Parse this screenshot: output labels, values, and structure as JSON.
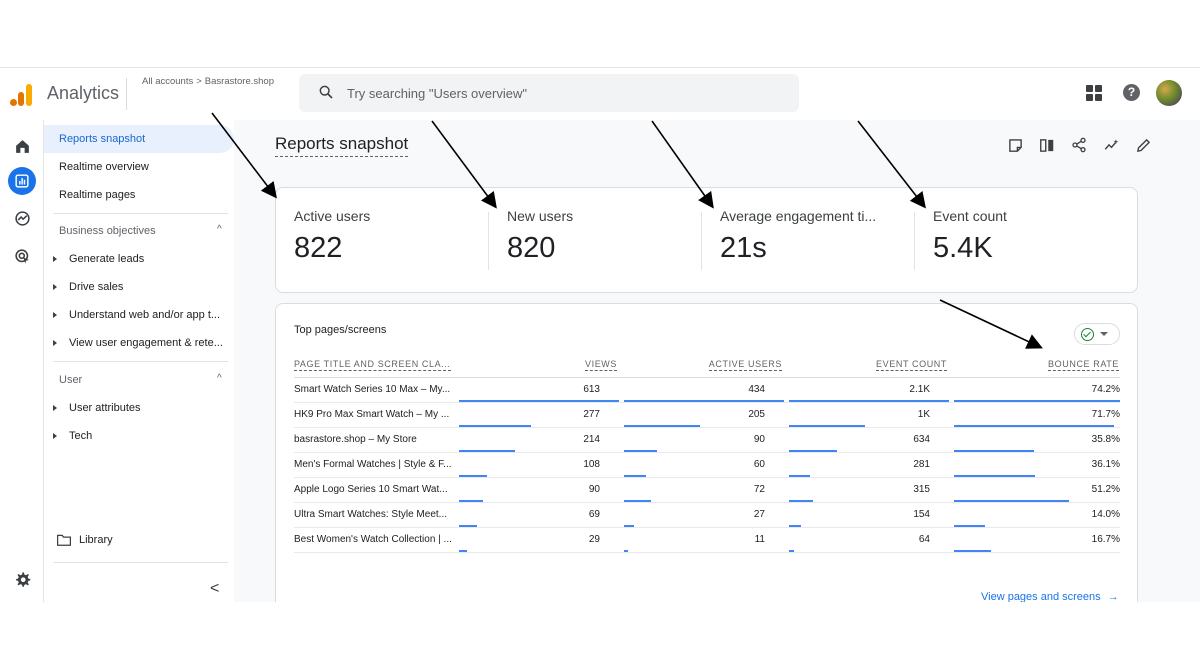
{
  "app": {
    "name": "Analytics",
    "breadcrumb": [
      "All accounts",
      "Basrastore.shop"
    ],
    "breadcrumb_sep": ">",
    "search_placeholder": "Try searching \"Users overview\"",
    "help_glyph": "?"
  },
  "icons": {
    "logo": "analytics-logo-icon",
    "search": "search-icon",
    "apps": "apps-grid-icon",
    "help": "help-icon",
    "home": "home-icon",
    "reports": "reports-icon",
    "explore": "explore-icon",
    "advertising": "advertising-icon",
    "settings": "gear-icon",
    "folder": "folder-icon"
  },
  "colors": {
    "accent": "#1a73e8",
    "active_bg": "#e8f0fe",
    "bar": "#4285f4",
    "logo_orange": "#e37400",
    "logo_yellow": "#f9ab00",
    "ok_green": "#188038"
  },
  "sidebar": {
    "items": [
      {
        "label": "Reports snapshot",
        "active": true
      },
      {
        "label": "Realtime overview",
        "active": false
      },
      {
        "label": "Realtime pages",
        "active": false
      }
    ],
    "sections": [
      {
        "title": "Business objectives",
        "caret": "^",
        "items": [
          "Generate leads",
          "Drive sales",
          "Understand web and/or app t...",
          "View user engagement & rete..."
        ]
      },
      {
        "title": "User",
        "caret": "^",
        "items": [
          "User attributes",
          "Tech"
        ]
      }
    ],
    "library": "Library",
    "collapse_glyph": "<"
  },
  "main": {
    "title": "Reports snapshot",
    "toolbar": [
      "customize-icon",
      "compare-icon",
      "share-icon",
      "insights-icon",
      "edit-icon"
    ],
    "metrics": [
      {
        "label": "Active users",
        "value": "822"
      },
      {
        "label": "New users",
        "value": "820"
      },
      {
        "label": "Average engagement ti...",
        "value": "21s"
      },
      {
        "label": "Event count",
        "value": "5.4K"
      }
    ],
    "table": {
      "title": "Top pages/screens",
      "headers": [
        "PAGE TITLE AND SCREEN CLA...",
        "VIEWS",
        "ACTIVE USERS",
        "EVENT COUNT",
        "BOUNCE RATE"
      ],
      "rows": [
        {
          "name": "Smart Watch Series 10 Max – My...",
          "views": "613",
          "active": "434",
          "events": "2.1K",
          "bounce": "74.2%"
        },
        {
          "name": "HK9 Pro Max Smart Watch – My ...",
          "views": "277",
          "active": "205",
          "events": "1K",
          "bounce": "71.7%"
        },
        {
          "name": "basrastore.shop – My Store",
          "views": "214",
          "active": "90",
          "events": "634",
          "bounce": "35.8%"
        },
        {
          "name": "Men's Formal Watches | Style & F...",
          "views": "108",
          "active": "60",
          "events": "281",
          "bounce": "36.1%"
        },
        {
          "name": "Apple Logo Series 10 Smart Wat...",
          "views": "90",
          "active": "72",
          "events": "315",
          "bounce": "51.2%"
        },
        {
          "name": "Ultra Smart Watches: Style Meet...",
          "views": "69",
          "active": "27",
          "events": "154",
          "bounce": "14.0%"
        },
        {
          "name": "Best Women's Watch Collection | ...",
          "views": "29",
          "active": "11",
          "events": "64",
          "bounce": "16.7%"
        }
      ],
      "bar_fractions": {
        "views": [
          1.0,
          0.452,
          0.349,
          0.176,
          0.147,
          0.113,
          0.047
        ],
        "active": [
          1.0,
          0.472,
          0.207,
          0.138,
          0.166,
          0.062,
          0.025
        ],
        "events": [
          1.0,
          0.476,
          0.302,
          0.134,
          0.15,
          0.073,
          0.03
        ],
        "bounce": [
          1.0,
          0.966,
          0.482,
          0.487,
          0.69,
          0.189,
          0.225
        ]
      },
      "link": "View pages and screens",
      "link_arrow": "→"
    }
  }
}
